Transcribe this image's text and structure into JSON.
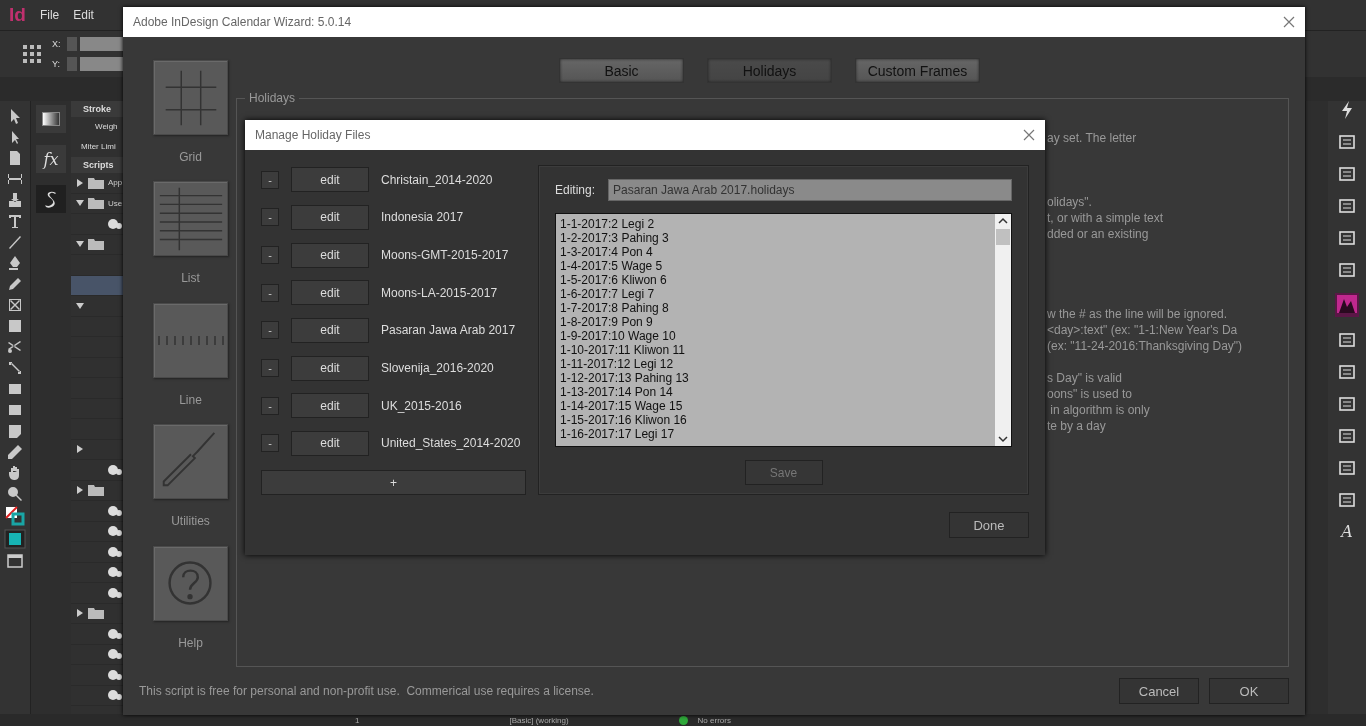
{
  "app": {
    "logo": "Id",
    "menu": [
      "File",
      "Edit"
    ],
    "control_bar": {
      "x_label": "X:",
      "y_label": "Y:"
    },
    "effects_label": "fx",
    "stroke_panel": {
      "title": "Stroke",
      "labels": [
        "Weigh",
        "Miter Limi"
      ]
    },
    "scripts_panel": {
      "title": "Scripts",
      "rows": [
        {
          "kind": "folder",
          "label": "App",
          "expanded": false,
          "selected": false
        },
        {
          "kind": "folder",
          "label": "Use",
          "expanded": true,
          "selected": false
        },
        {
          "kind": "script",
          "selected": false
        },
        {
          "kind": "folder",
          "expanded": true,
          "selected": false
        },
        {
          "kind": "blank",
          "selected": false
        },
        {
          "kind": "blank",
          "selected": true
        },
        {
          "kind": "branch",
          "expanded": true,
          "selected": false
        },
        {
          "kind": "blank",
          "selected": false
        },
        {
          "kind": "blank",
          "selected": false
        },
        {
          "kind": "blank",
          "selected": false
        },
        {
          "kind": "blank",
          "selected": false
        },
        {
          "kind": "blank",
          "selected": false
        },
        {
          "kind": "blank",
          "selected": false
        },
        {
          "kind": "branch",
          "expanded": false,
          "selected": false
        },
        {
          "kind": "script",
          "selected": false
        },
        {
          "kind": "folder",
          "expanded": false,
          "selected": false
        },
        {
          "kind": "script",
          "selected": false
        },
        {
          "kind": "script",
          "selected": false
        },
        {
          "kind": "script",
          "selected": false
        },
        {
          "kind": "script",
          "selected": false
        },
        {
          "kind": "script",
          "selected": false
        },
        {
          "kind": "folder",
          "expanded": false,
          "selected": false
        },
        {
          "kind": "script",
          "selected": false
        },
        {
          "kind": "script",
          "selected": false
        },
        {
          "kind": "script",
          "selected": false
        },
        {
          "kind": "script",
          "selected": false
        }
      ]
    },
    "glyphs_icon": "A",
    "status_bar": {
      "page": "1",
      "style": "[Basic] (working)",
      "preflight": "No errors"
    }
  },
  "wizard": {
    "title": "Adobe InDesign Calendar Wizard: 5.0.14",
    "tabs": [
      {
        "label": "Basic",
        "selected": false
      },
      {
        "label": "Holidays",
        "selected": true
      },
      {
        "label": "Custom Frames",
        "selected": false
      }
    ],
    "nav": [
      {
        "kind": "grid",
        "label": "Grid"
      },
      {
        "kind": "list",
        "label": "List"
      },
      {
        "kind": "line",
        "label": "Line"
      },
      {
        "kind": "utilities",
        "label": "Utilities"
      },
      {
        "kind": "help",
        "label": "Help"
      }
    ],
    "section": {
      "title": "Holidays",
      "paragraphs": [
        [
          "ay set. The letter"
        ],
        [
          "olidays\".",
          "t, or with a simple text",
          "dded or an existing"
        ],
        [
          "w the # as the line will be ignored.",
          "<day>:text\" (ex: \"1-1:New Year's Da",
          "(ex: \"11-24-2016:Thanksgiving Day\")"
        ],
        [
          "s Day\" is valid",
          "oons\" is used to",
          " in algorithm is only",
          "te by a day"
        ]
      ]
    },
    "footer": "This script is free for personal and non-profit use.  Commerical use requires a license.",
    "buttons": [
      "Cancel",
      "OK"
    ]
  },
  "dialog": {
    "title": "Manage Holiday Files",
    "files": [
      {
        "remove": "-",
        "edit": "edit",
        "name": "Christain_2014-2020"
      },
      {
        "remove": "-",
        "edit": "edit",
        "name": "Indonesia 2017"
      },
      {
        "remove": "-",
        "edit": "edit",
        "name": "Moons-GMT-2015-2017"
      },
      {
        "remove": "-",
        "edit": "edit",
        "name": "Moons-LA-2015-2017"
      },
      {
        "remove": "-",
        "edit": "edit",
        "name": "Pasaran Jawa Arab 2017"
      },
      {
        "remove": "-",
        "edit": "edit",
        "name": "Slovenija_2016-2020"
      },
      {
        "remove": "-",
        "edit": "edit",
        "name": "UK_2015-2016"
      },
      {
        "remove": "-",
        "edit": "edit",
        "name": "United_States_2014-2020"
      }
    ],
    "add_button": "+",
    "editing_label": "Editing:",
    "editing_value": "Pasaran Jawa Arab 2017.holidays",
    "lines": [
      "1-1-2017:2 Legi 2",
      "1-2-2017:3 Pahing 3",
      "1-3-2017:4 Pon 4",
      "1-4-2017:5 Wage 5",
      "1-5-2017:6 Kliwon 6",
      "1-6-2017:7 Legi 7",
      "1-7-2017:8 Pahing 8",
      "1-8-2017:9 Pon 9",
      "1-9-2017:10 Wage 10",
      "1-10-2017:11 Kliwon 11",
      "1-11-2017:12 Legi 12",
      "1-12-2017:13 Pahing 13",
      "1-13-2017:14 Pon 14",
      "1-14-2017:15 Wage 15",
      "1-15-2017:16 Kliwon 16",
      "1-16-2017:17 Legi 17"
    ],
    "save": {
      "label": "Save",
      "disabled": true
    },
    "done": "Done"
  }
}
